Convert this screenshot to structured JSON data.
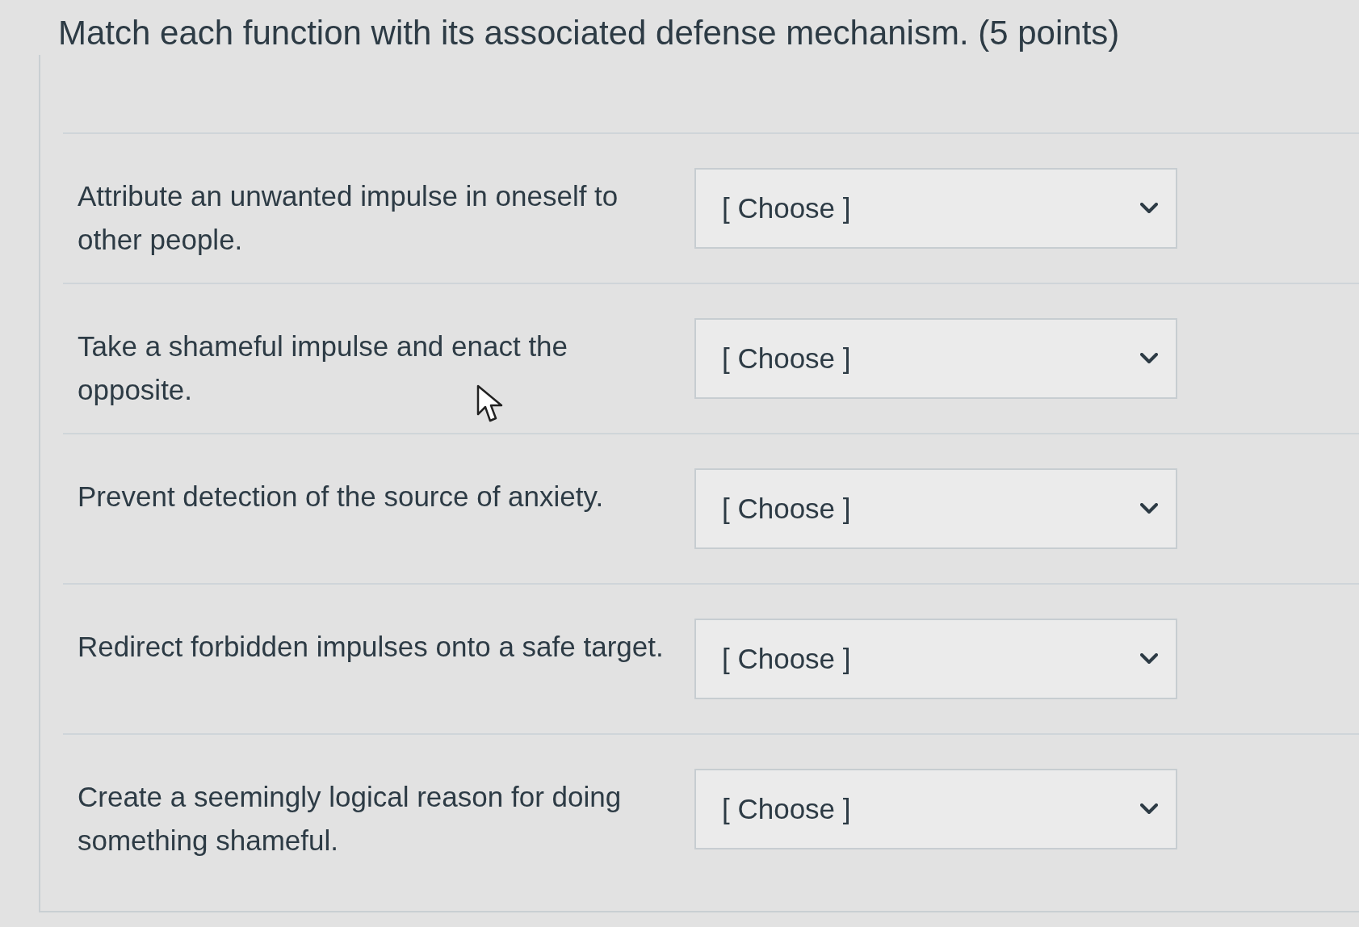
{
  "question": {
    "title": "Match each function with its associated defense mechanism. (5 points)"
  },
  "rows": [
    {
      "prompt": "Attribute an unwanted impulse in oneself to other people.",
      "answer": "[ Choose ]"
    },
    {
      "prompt": "Take a shameful impulse and enact the opposite.",
      "answer": "[ Choose ]",
      "cursor": true
    },
    {
      "prompt": "Prevent detection of the source of anxiety.",
      "answer": "[ Choose ]"
    },
    {
      "prompt": "Redirect forbidden impulses onto a safe target.",
      "answer": "[ Choose ]"
    },
    {
      "prompt": "Create a seemingly logical reason for doing something shameful.",
      "answer": "[ Choose ]"
    }
  ]
}
